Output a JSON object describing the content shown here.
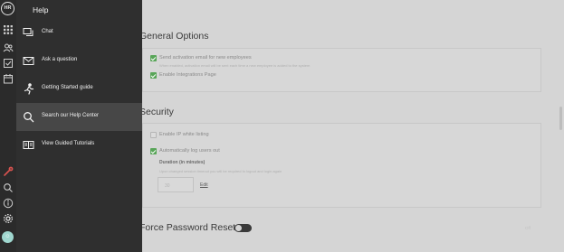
{
  "rail": {
    "logo_text": "HR",
    "icons": [
      "grid-icon",
      "people-icon",
      "checklist-icon",
      "calendar-icon",
      "wrench-icon",
      "search-icon",
      "info-icon",
      "gear-icon"
    ],
    "avatar_color": "#9fd7cf"
  },
  "help_panel": {
    "title": "Help",
    "items": [
      {
        "label": "Chat",
        "icon": "chat-icon"
      },
      {
        "label": "Ask a question",
        "icon": "mail-icon"
      },
      {
        "label": "Getting Started guide",
        "icon": "runner-icon"
      },
      {
        "label": "Search our Help Center",
        "icon": "search-icon"
      },
      {
        "label": "View Guided Tutorials",
        "icon": "book-icon"
      }
    ],
    "active_index": 3
  },
  "content": {
    "general_title": "General Options",
    "general_options": [
      {
        "label": "Send activation email for new employees",
        "checked": true
      },
      {
        "label": "Enable Integrations Page",
        "checked": true
      }
    ],
    "general_hint": "When enabled, activation email will be sent each time a new employee is added to the system",
    "security_title": "Security",
    "security_options": [
      {
        "label": "Enable IP white listing",
        "checked": false
      },
      {
        "label": "Automatically log users out",
        "checked": true
      }
    ],
    "duration_label": "Duration (in minutes)",
    "duration_hint": "Upon changed session timeout you will be required to logout and login again",
    "duration_value": "30",
    "edit_label": "Edit",
    "force_reset_title": "Force Password Reset",
    "faint_right": "Off",
    "colors": {
      "checkbox_on": "#58a558",
      "panel_bg": "#2f2f2f",
      "panel_active": "#474747",
      "toggle_wrench": "#d9534f"
    }
  }
}
